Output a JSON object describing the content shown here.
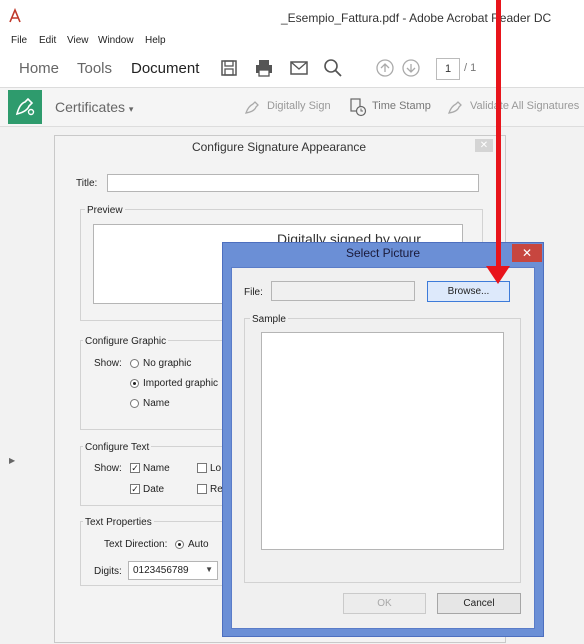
{
  "window": {
    "title": "_Esempio_Fattura.pdf - Adobe Acrobat Reader DC"
  },
  "menu": [
    "File",
    "Edit",
    "View",
    "Window",
    "Help"
  ],
  "toolbar": {
    "nav": [
      "Home",
      "Tools",
      "Document"
    ],
    "page_current": "1",
    "page_total": "/ 1",
    "icons": [
      "save-icon",
      "print-icon",
      "email-icon",
      "search-icon",
      "page-up-icon",
      "page-down-icon"
    ]
  },
  "signbar": {
    "certificates": "Certificates",
    "actions": [
      "Digitally Sign",
      "Time Stamp",
      "Validate All Signatures"
    ]
  },
  "configure_dialog": {
    "title": "Configure Signature Appearance",
    "title_label": "Title:",
    "title_value": "",
    "preview_label": "Preview",
    "preview_text": "Digitally signed by your",
    "graphic_group": "Configure Graphic",
    "show_label": "Show:",
    "graphic_options": [
      "No graphic",
      "Imported graphic",
      "Name"
    ],
    "text_group": "Configure Text",
    "text_show_label": "Show:",
    "text_options": [
      "Name",
      "Date",
      "Lo",
      "Re"
    ],
    "props_group": "Text Properties",
    "direction_label": "Text Direction:",
    "direction_value": "Auto",
    "digits_label": "Digits:",
    "digits_value": "0123456789"
  },
  "select_picture": {
    "title": "Select Picture",
    "file_label": "File:",
    "file_value": "",
    "browse_label": "Browse...",
    "sample_label": "Sample",
    "ok_label": "OK",
    "cancel_label": "Cancel"
  },
  "colors": {
    "accent_green": "#2e9b6d",
    "dialog_frame": "#6b8fd6",
    "annotation_red": "#e8141b"
  }
}
